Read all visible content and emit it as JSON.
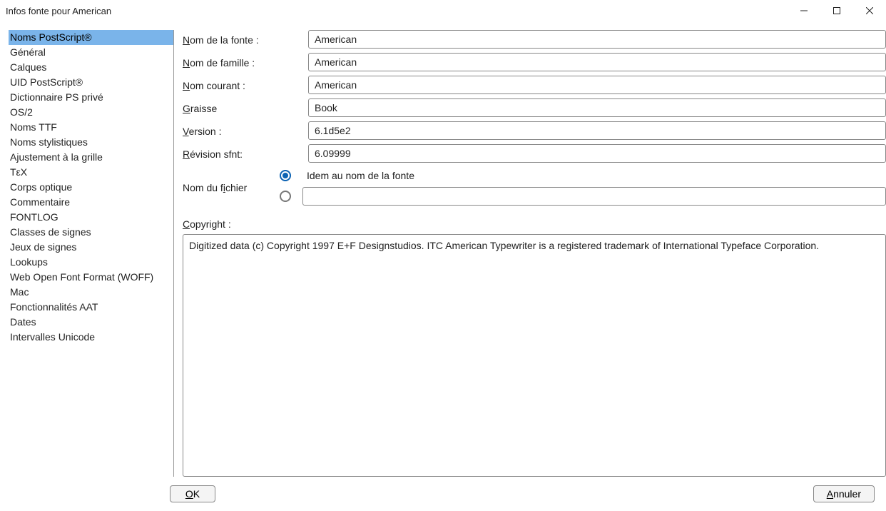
{
  "window": {
    "title": "Infos fonte pour American"
  },
  "sidebar": {
    "items": [
      {
        "label": "Noms PostScript®",
        "selected": true
      },
      {
        "label": "Général",
        "selected": false
      },
      {
        "label": "Calques",
        "selected": false
      },
      {
        "label": "UID PostScript®",
        "selected": false
      },
      {
        "label": "Dictionnaire PS privé",
        "selected": false
      },
      {
        "label": "OS/2",
        "selected": false
      },
      {
        "label": "Noms TTF",
        "selected": false
      },
      {
        "label": "Noms stylistiques",
        "selected": false
      },
      {
        "label": "Ajustement à la grille",
        "selected": false
      },
      {
        "label": "TεX",
        "selected": false
      },
      {
        "label": "Corps optique",
        "selected": false
      },
      {
        "label": "Commentaire",
        "selected": false
      },
      {
        "label": "FONTLOG",
        "selected": false
      },
      {
        "label": "Classes de signes",
        "selected": false
      },
      {
        "label": "Jeux de signes",
        "selected": false
      },
      {
        "label": "Lookups",
        "selected": false
      },
      {
        "label": "Web Open Font Format (WOFF)",
        "selected": false
      },
      {
        "label": "Mac",
        "selected": false
      },
      {
        "label": "Fonctionnalités AAT",
        "selected": false
      },
      {
        "label": "Dates",
        "selected": false
      },
      {
        "label": "Intervalles Unicode",
        "selected": false
      }
    ]
  },
  "form": {
    "fontname_label_pre": "N",
    "fontname_label_rest": "om de la fonte :",
    "family_label_pre": "N",
    "family_label_rest": "om de famille :",
    "fullname_label_pre": "N",
    "fullname_label_rest": "om courant :",
    "weight_label_pre": "G",
    "weight_label_rest": "raisse",
    "version_label_pre": "V",
    "version_label_rest": "ersion :",
    "sfnt_label_pre": "R",
    "sfnt_label_rest": "évision sfnt:",
    "filename_label_pre": "Nom du f",
    "filename_label_underline": "i",
    "filename_label_post": "chier",
    "radio_same_label": "Idem au nom de la fonte",
    "copyright_label_pre": "C",
    "copyright_label_rest": "opyright :",
    "fontname": "American",
    "family": "American",
    "fullname": "American",
    "weight": "Book",
    "version": "6.1d5e2",
    "sfnt": "6.09999",
    "filename_custom": "",
    "copyright": "Digitized data (c) Copyright 1997 E+F Designstudios. ITC American Typewriter is a registered trademark of International Typeface Corporation."
  },
  "buttons": {
    "ok_pre": "",
    "ok_underline": "O",
    "ok_post": "K",
    "cancel_pre": "",
    "cancel_underline": "A",
    "cancel_post": "nnuler"
  }
}
